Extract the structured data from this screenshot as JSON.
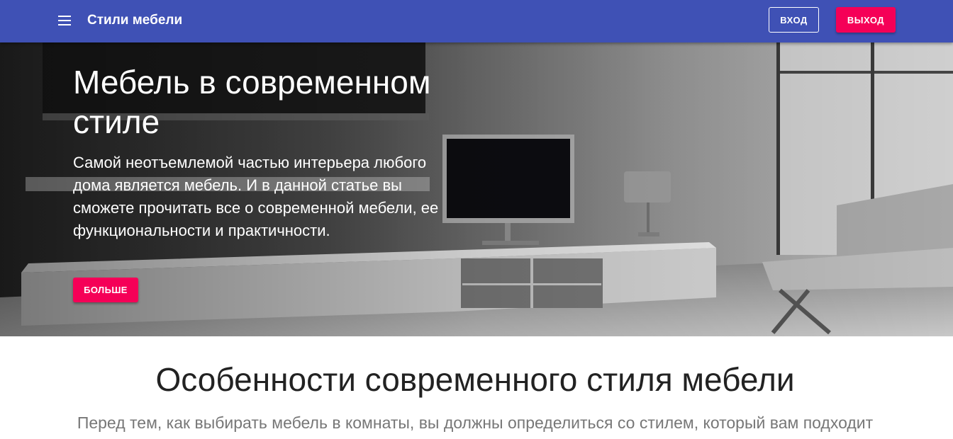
{
  "appbar": {
    "menu_icon": "hamburger-menu-icon",
    "title": "Стили мебели",
    "login_label": "ВХОД",
    "logout_label": "ВЫХОД",
    "background_color": "#3f51b5",
    "accent_color": "#f50057"
  },
  "hero": {
    "title": "Мебель в современном стиле",
    "text": "Самой неотъемлемой частью интерьера любого дома является мебель. И в данной статье вы сможете прочитать все о современной мебели, ее функциональности и практичности.",
    "more_label": "БОЛЬШЕ"
  },
  "section": {
    "title": "Особенности современного стиля мебели",
    "text": "Перед тем, как выбирать мебель в комнаты, вы должны определиться со стилем, который вам подходит"
  }
}
